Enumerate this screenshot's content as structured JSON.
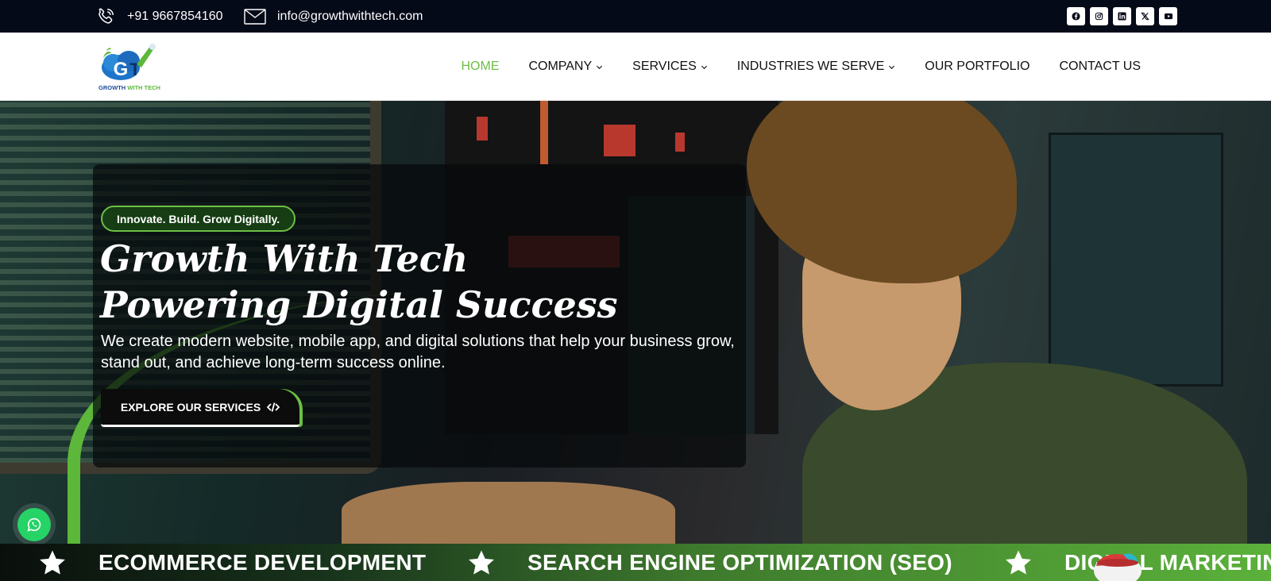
{
  "topbar": {
    "phone": "+91 9667854160",
    "email": "info@growthwithtech.com",
    "socials": [
      "facebook-icon",
      "instagram-icon",
      "linkedin-icon",
      "x-icon",
      "youtube-icon"
    ]
  },
  "header": {
    "logo_text_1": "GROWTH",
    "logo_text_2": "WITH TECH",
    "nav": [
      {
        "label": "HOME",
        "active": true
      },
      {
        "label": "COMPANY",
        "dropdown": true
      },
      {
        "label": "SERVICES",
        "dropdown": true
      },
      {
        "label": "INDUSTRIES WE SERVE",
        "dropdown": true
      },
      {
        "label": "OUR PORTFOLIO"
      },
      {
        "label": "CONTACT US"
      }
    ]
  },
  "hero": {
    "tagline": "Innovate. Build. Grow Digitally.",
    "title_line1": "Growth With Tech",
    "title_line2": "Powering Digital Success",
    "subtitle": "We create modern website, mobile app, and digital solutions that help your business grow, stand out, and achieve long-term success online.",
    "cta": "EXPLORE OUR SERVICES"
  },
  "marquee": {
    "items": [
      "ECOMMERCE DEVELOPMENT",
      "SEARCH ENGINE OPTIMIZATION (SEO)",
      "DIGITAL MARKETING"
    ]
  },
  "colors": {
    "accent": "#6cbf45",
    "topbar_bg": "#050a18",
    "whatsapp": "#25d366"
  }
}
